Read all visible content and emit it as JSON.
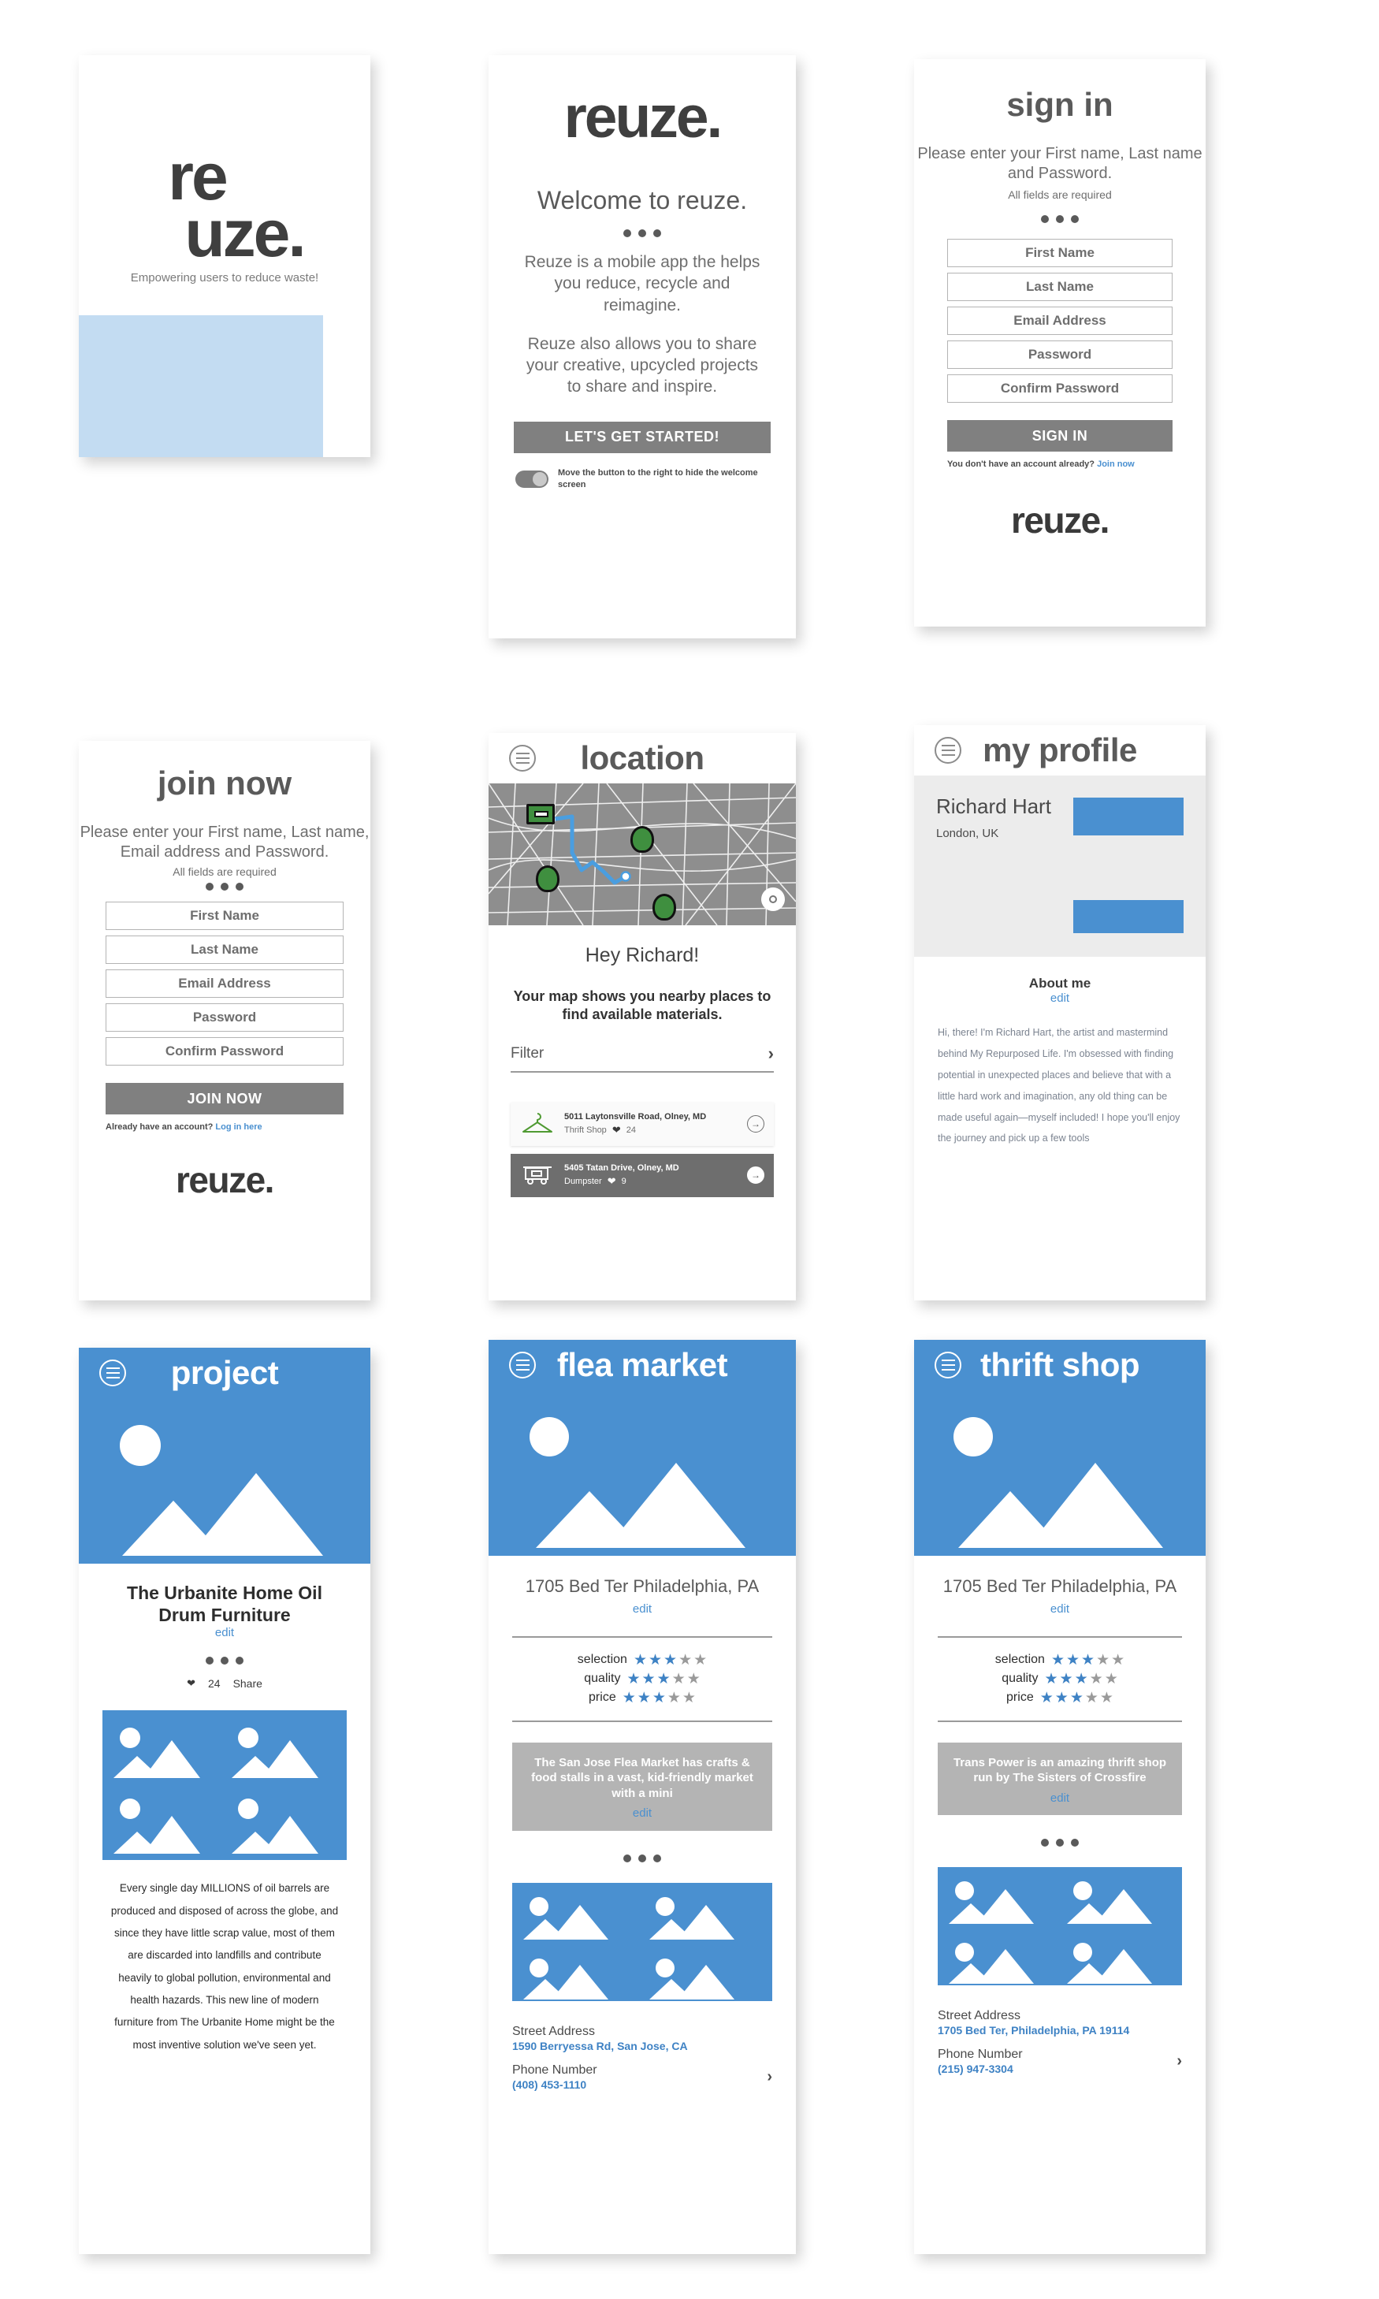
{
  "brand": {
    "wordmark": "reuze.",
    "logo_line1": "re",
    "logo_line2": "uze.",
    "tagline": "Empowering users to reduce waste!",
    "accent_blue": "#4a90d0",
    "swatch_blue": "#c3dcf2",
    "gray_button": "#808080"
  },
  "welcome": {
    "logo": "reuze.",
    "heading": "Welcome to reuze.",
    "paragraph1": "Reuze is a mobile app the helps you reduce, recycle and reimagine.",
    "paragraph2": "Reuze also allows you to share your creative, upcycled projects to share and inspire.",
    "cta": "LET'S GET STARTED!",
    "toggle_label": "Move the button to the right to hide the welcome screen"
  },
  "signin": {
    "title": "sign in",
    "subtitle": "Please enter your First name, Last name and Password.",
    "required_note": "All fields are required",
    "fields": [
      "First Name",
      "Last Name",
      "Email Address",
      "Password",
      "Confirm Password"
    ],
    "cta": "SIGN IN",
    "footer_text": "You don't have an account already?",
    "footer_link": "Join now",
    "wordmark": "reuze."
  },
  "joinnow": {
    "title": "join now",
    "subtitle": "Please enter your First name, Last name, Email address and Password.",
    "required_note": "All fields are required",
    "fields": [
      "First Name",
      "Last Name",
      "Email Address",
      "Password",
      "Confirm Password"
    ],
    "cta": "JOIN NOW",
    "footer_text": "Already have an account?",
    "footer_link": "Log in here",
    "wordmark": "reuze."
  },
  "location": {
    "title": "location",
    "greeting": "Hey Richard!",
    "description": "Your map shows you nearby places to find available materials.",
    "filter_label": "Filter",
    "places": [
      {
        "address": "5011 Laytonsville Road, Olney, MD",
        "type": "Thrift Shop",
        "likes": "24",
        "icon": "hanger-icon",
        "style": "light"
      },
      {
        "address": "5405 Tatan Drive, Olney, MD",
        "type": "Dumpster",
        "likes": "9",
        "icon": "dumpster-icon",
        "style": "dark"
      }
    ]
  },
  "profile": {
    "title": "my profile",
    "name": "Richard Hart",
    "location": "London, UK",
    "about_heading": "About me",
    "edit": "edit",
    "bio": "Hi, there! I'm Richard Hart, the artist and mastermind behind My Repurposed Life. I'm obsessed with finding potential in unexpected places and believe that with a little hard work and imagination, any old thing can be made useful again—myself included! I hope you'll enjoy the journey and pick up a few tools"
  },
  "project": {
    "title": "project",
    "name": "The Urbanite Home Oil Drum Furniture",
    "edit": "edit",
    "likes": "24",
    "share": "Share",
    "body": "Every single day MILLIONS of oil barrels are produced and disposed of across the globe, and since they have little scrap value, most of them are discarded into landfills and contribute heavily to global pollution, environmental and health hazards. This new line of modern furniture from The Urbanite Home might be the most inventive solution we've seen yet."
  },
  "flea_market": {
    "title": "flea market",
    "address": "1705 Bed Ter Philadelphia, PA",
    "edit": "edit",
    "ratings": [
      {
        "label": "selection",
        "value": 3,
        "max": 5
      },
      {
        "label": "quality",
        "value": 3,
        "max": 5
      },
      {
        "label": "price",
        "value": 3,
        "max": 5
      }
    ],
    "blurb": "The San Jose Flea Market has crafts & food stalls in a vast, kid-friendly market with a mini",
    "info": [
      {
        "key": "Street Address",
        "value": "1590 Berryessa Rd, San Jose, CA"
      },
      {
        "key": "Phone Number",
        "value": "(408) 453-1110"
      }
    ]
  },
  "thrift_shop": {
    "title": "thrift shop",
    "address": "1705 Bed Ter Philadelphia, PA",
    "edit": "edit",
    "ratings": [
      {
        "label": "selection",
        "value": 3,
        "max": 5
      },
      {
        "label": "quality",
        "value": 3,
        "max": 5
      },
      {
        "label": "price",
        "value": 3,
        "max": 5
      }
    ],
    "blurb": "Trans Power is an amazing thrift shop run by The Sisters of Crossfire",
    "info": [
      {
        "key": "Street Address",
        "value": "1705 Bed Ter, Philadelphia, PA 19114"
      },
      {
        "key": "Phone Number",
        "value": "(215) 947-3304"
      }
    ]
  }
}
